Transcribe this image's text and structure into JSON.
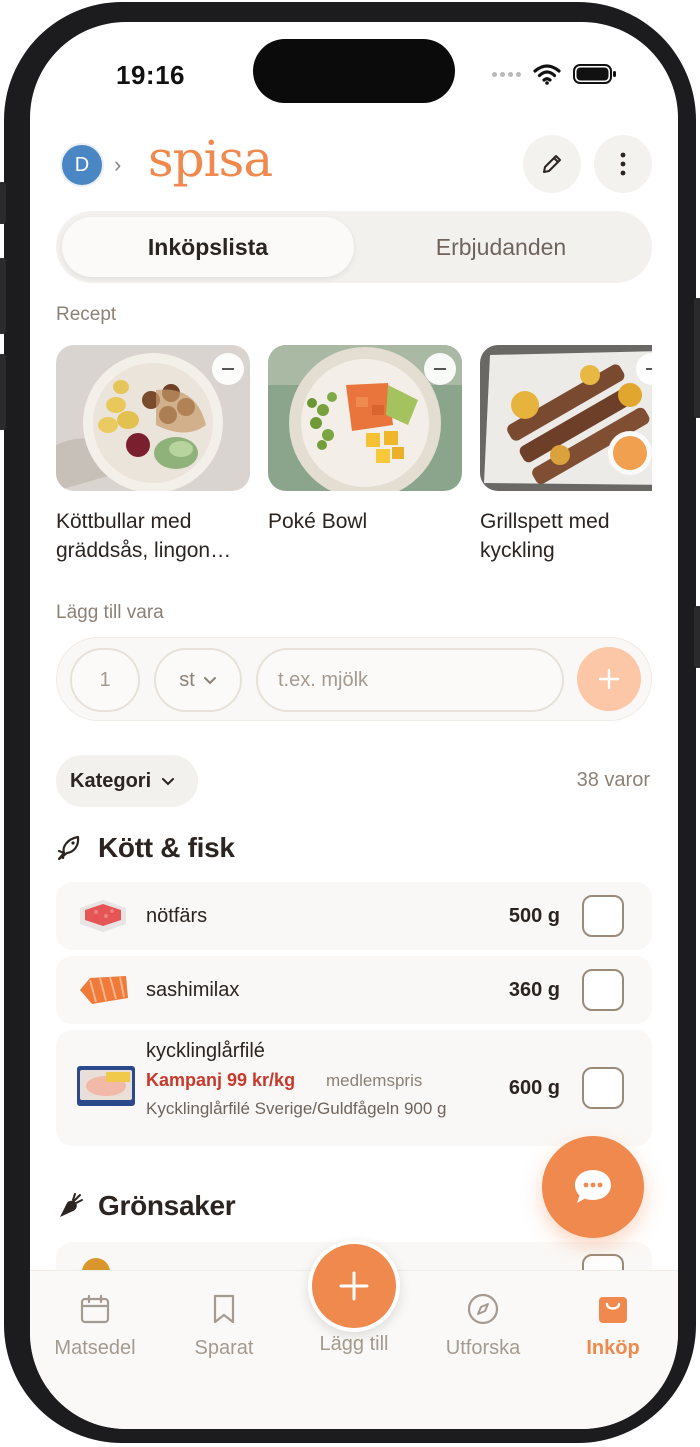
{
  "status": {
    "time": "19:16"
  },
  "header": {
    "avatar_initial": "D",
    "logo": "spisa"
  },
  "tabs": {
    "active": "Inköpslista",
    "inactive": "Erbjudanden"
  },
  "recipes_section": {
    "label": "Recept",
    "items": [
      {
        "title": "Köttbullar med gräddsås, lingon…"
      },
      {
        "title": "Poké Bowl"
      },
      {
        "title": "Grillspett med kyckling"
      }
    ]
  },
  "add_item": {
    "label": "Lägg till vara",
    "quantity": "1",
    "unit": "st",
    "placeholder": "t.ex. mjölk"
  },
  "filter": {
    "label": "Kategori",
    "count": "38 varor"
  },
  "groups": [
    {
      "title": "Kött & fisk",
      "icon": "fish-icon",
      "items": [
        {
          "name": "nötfärs",
          "qty": "500 g",
          "checked": false
        },
        {
          "name": "sashimilax",
          "qty": "360 g",
          "checked": false
        },
        {
          "name": "kycklinglårfilé",
          "qty": "600 g",
          "campaign": "Kampanj 99 kr/kg",
          "campaign_note": "medlemspris",
          "product": "Kycklinglårfilé Sverige/Guldfågeln 900 g",
          "checked": false
        }
      ]
    },
    {
      "title": "Grönsaker",
      "icon": "carrot-icon",
      "items": []
    }
  ],
  "tabbar": {
    "items": [
      {
        "label": "Matsedel",
        "icon": "calendar-icon"
      },
      {
        "label": "Sparat",
        "icon": "bookmark-icon"
      },
      {
        "label": "Lägg till",
        "icon": "plus-icon"
      },
      {
        "label": "Utforska",
        "icon": "compass-icon"
      },
      {
        "label": "Inköp",
        "icon": "shopping-bag-icon"
      }
    ],
    "active": "Inköp"
  },
  "colors": {
    "accent": "#f0894d",
    "campaign": "#c8392b",
    "text": "#2b2420",
    "muted": "#8c8176"
  }
}
